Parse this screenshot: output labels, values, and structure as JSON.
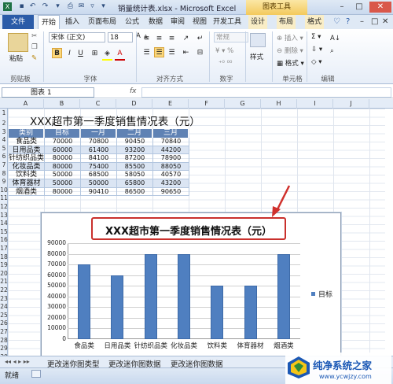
{
  "window": {
    "title": "销量统计表.xlsx - Microsoft Excel",
    "chart_tools": "图表工具"
  },
  "tabs": [
    "文件",
    "开始",
    "插入",
    "页面布局",
    "公式",
    "数据",
    "审阅",
    "视图",
    "开发工具",
    "设计",
    "布局",
    "格式"
  ],
  "ribbon": {
    "paste": "粘贴",
    "font_name": "宋体 (正文)",
    "font_size": "18",
    "number_format": "常规",
    "style": "样式",
    "insert": "插入",
    "delete": "删除",
    "format": "格式",
    "groups": [
      "剪贴板",
      "字体",
      "对齐方式",
      "数字",
      "单元格",
      "编辑"
    ]
  },
  "formula_bar": {
    "name_box": "图表 1",
    "fx": "fx",
    "value": ""
  },
  "columns": [
    "A",
    "B",
    "C",
    "D",
    "E",
    "F",
    "G",
    "H",
    "I",
    "J"
  ],
  "rows": [
    "1",
    "2",
    "3",
    "4",
    "5",
    "6",
    "7",
    "8",
    "9",
    "10",
    "11",
    "12",
    "13",
    "14",
    "15",
    "16",
    "17",
    "18",
    "19",
    "20",
    "21",
    "22",
    "23",
    "24",
    "25",
    "26",
    "27",
    "28",
    "29",
    "30"
  ],
  "sheet": {
    "title": "XXX超市第一季度销售情况表（元）",
    "headers": [
      "类别",
      "目标",
      "一月",
      "二月",
      "三月"
    ],
    "table": [
      [
        "食品类",
        "70000",
        "70800",
        "90450",
        "70840"
      ],
      [
        "日用品类",
        "60000",
        "61400",
        "93200",
        "44200"
      ],
      [
        "针纺织品类",
        "80000",
        "84100",
        "87200",
        "78900"
      ],
      [
        "化妆品类",
        "80000",
        "75400",
        "85500",
        "88050"
      ],
      [
        "饮料类",
        "50000",
        "68500",
        "58050",
        "40570"
      ],
      [
        "体育器材",
        "50000",
        "50000",
        "65800",
        "43200"
      ],
      [
        "烟酒类",
        "80000",
        "90410",
        "86500",
        "90650"
      ]
    ]
  },
  "chart_data": {
    "type": "bar",
    "title": "XXX超市第一季度销售情况表（元）",
    "categories": [
      "食品类",
      "日用品类",
      "针纺织品类",
      "化妆品类",
      "饮料类",
      "体育器材",
      "烟酒类"
    ],
    "series": [
      {
        "name": "目标",
        "values": [
          70000,
          60000,
          80000,
          80000,
          50000,
          50000,
          80000
        ],
        "color": "#4f7fc0"
      }
    ],
    "yticks": [
      "0",
      "10000",
      "20000",
      "30000",
      "40000",
      "50000",
      "60000",
      "70000",
      "80000",
      "90000"
    ],
    "ylim": [
      0,
      90000
    ],
    "grid": true,
    "legend": "right"
  },
  "sheet_tabs": [
    "更改迷你图类型",
    "更改迷你图数据",
    "更改迷你图数据"
  ],
  "status": {
    "ready": "就绪"
  },
  "watermark": {
    "name": "纯净系统之家",
    "url": "www.ycwjzy.com"
  }
}
